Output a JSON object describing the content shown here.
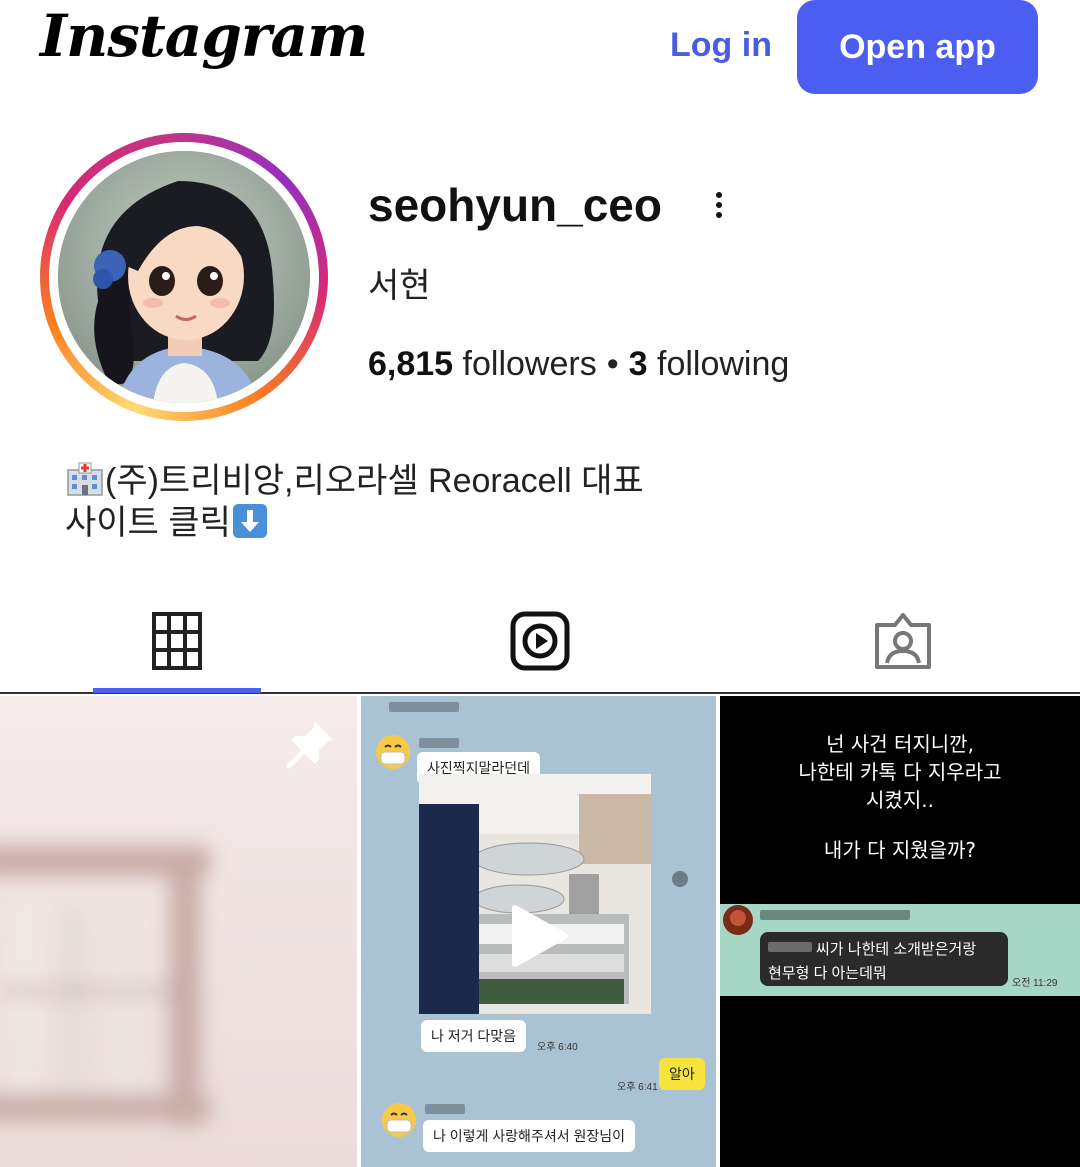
{
  "header": {
    "logo_text": "Instagram",
    "login_label": "Log in",
    "open_app_label": "Open app"
  },
  "profile": {
    "username": "seohyun_ceo",
    "full_name": "서현",
    "followers_count": "6,815",
    "followers_label": "followers",
    "separator": "•",
    "following_count": "3",
    "following_label": "following",
    "bio_line1_emoji": "hospital-emoji",
    "bio_line1": "(주)트리비앙,리오라셀 Reoracell 대표",
    "bio_line2": "사이트 클릭",
    "bio_line2_emoji": "down-arrow-emoji"
  },
  "tabs": [
    {
      "icon": "grid-icon",
      "active": true
    },
    {
      "icon": "reels-icon",
      "active": false
    },
    {
      "icon": "tagged-icon",
      "active": false
    }
  ],
  "posts": {
    "post1": {
      "icon": "pin-icon"
    },
    "post2": {
      "icon": "play-icon",
      "bubble1": "사진찍지말라던데",
      "bubble2": "나 저거 다맞음",
      "time1": "오후 6:40",
      "time2": "오후 6:41",
      "bubble3": "알아",
      "bubble4": "나 이렇게 사랑해주셔서 원장님이"
    },
    "post3": {
      "line1": "넌 사건 터지니깐,",
      "line2": "나한테 카톡 다 지우라고",
      "line3": "시켰지..",
      "line4": "내가 다 지웠을까?",
      "chat1": "씨가 나한테 소개받은거랑",
      "chat2": "현무형 다 아는데뭐",
      "time": "오전 11:29"
    }
  },
  "colors": {
    "accent": "#4c5df1",
    "login_text": "#4a5de0"
  }
}
